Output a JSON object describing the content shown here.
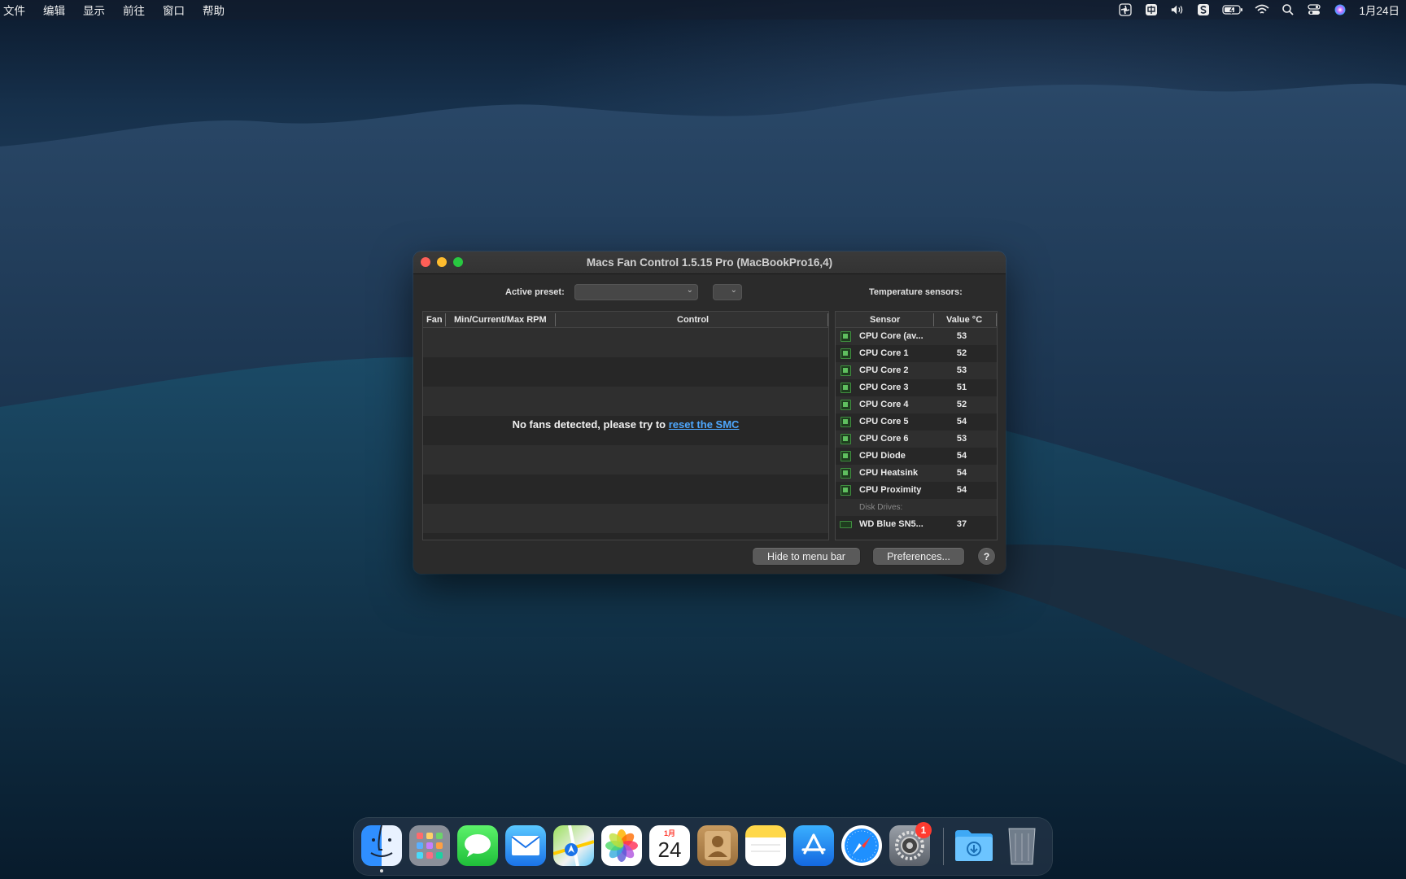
{
  "menubar": {
    "items": [
      "文件",
      "编辑",
      "显示",
      "前往",
      "窗口",
      "帮助"
    ],
    "date": "1月24日",
    "status_icons": [
      "fan-status-icon",
      "input-method-icon",
      "volume-icon",
      "scroll-app-icon",
      "battery-icon",
      "wifi-icon",
      "spotlight-search-icon",
      "control-center-icon",
      "siri-icon"
    ]
  },
  "window": {
    "title": "Macs Fan Control 1.5.15 Pro (MacBookPro16,4)",
    "active_preset_label": "Active preset:",
    "active_preset_value": "",
    "temp_sensors_label": "Temperature sensors:",
    "fans_table": {
      "headers": [
        "Fan",
        "Min/Current/Max RPM",
        "Control"
      ],
      "empty_message": "No fans detected, please try to ",
      "empty_link": "reset the SMC"
    },
    "sensors_table": {
      "headers": [
        "Sensor",
        "Value °C"
      ],
      "rows": [
        {
          "name": "CPU Core (av...",
          "value": "53",
          "kind": "chip"
        },
        {
          "name": "CPU Core 1",
          "value": "52",
          "kind": "chip"
        },
        {
          "name": "CPU Core 2",
          "value": "53",
          "kind": "chip"
        },
        {
          "name": "CPU Core 3",
          "value": "51",
          "kind": "chip"
        },
        {
          "name": "CPU Core 4",
          "value": "52",
          "kind": "chip"
        },
        {
          "name": "CPU Core 5",
          "value": "54",
          "kind": "chip"
        },
        {
          "name": "CPU Core 6",
          "value": "53",
          "kind": "chip"
        },
        {
          "name": "CPU Diode",
          "value": "54",
          "kind": "chip"
        },
        {
          "name": "CPU Heatsink",
          "value": "54",
          "kind": "chip"
        },
        {
          "name": "CPU Proximity",
          "value": "54",
          "kind": "chip"
        },
        {
          "name": "Disk Drives:",
          "value": "",
          "kind": "group"
        },
        {
          "name": "WD Blue SN5...",
          "value": "37",
          "kind": "disk"
        }
      ]
    },
    "buttons": {
      "hide": "Hide to menu bar",
      "prefs": "Preferences...",
      "help": "?"
    }
  },
  "dock": {
    "apps": [
      "finder",
      "launchpad",
      "messages",
      "mail",
      "maps",
      "photos",
      "calendar",
      "contacts",
      "notes",
      "app-store",
      "safari",
      "system-preferences",
      "downloads",
      "trash"
    ],
    "calendar_month": "1月",
    "calendar_day": "24",
    "system_prefs_badge": "1"
  }
}
